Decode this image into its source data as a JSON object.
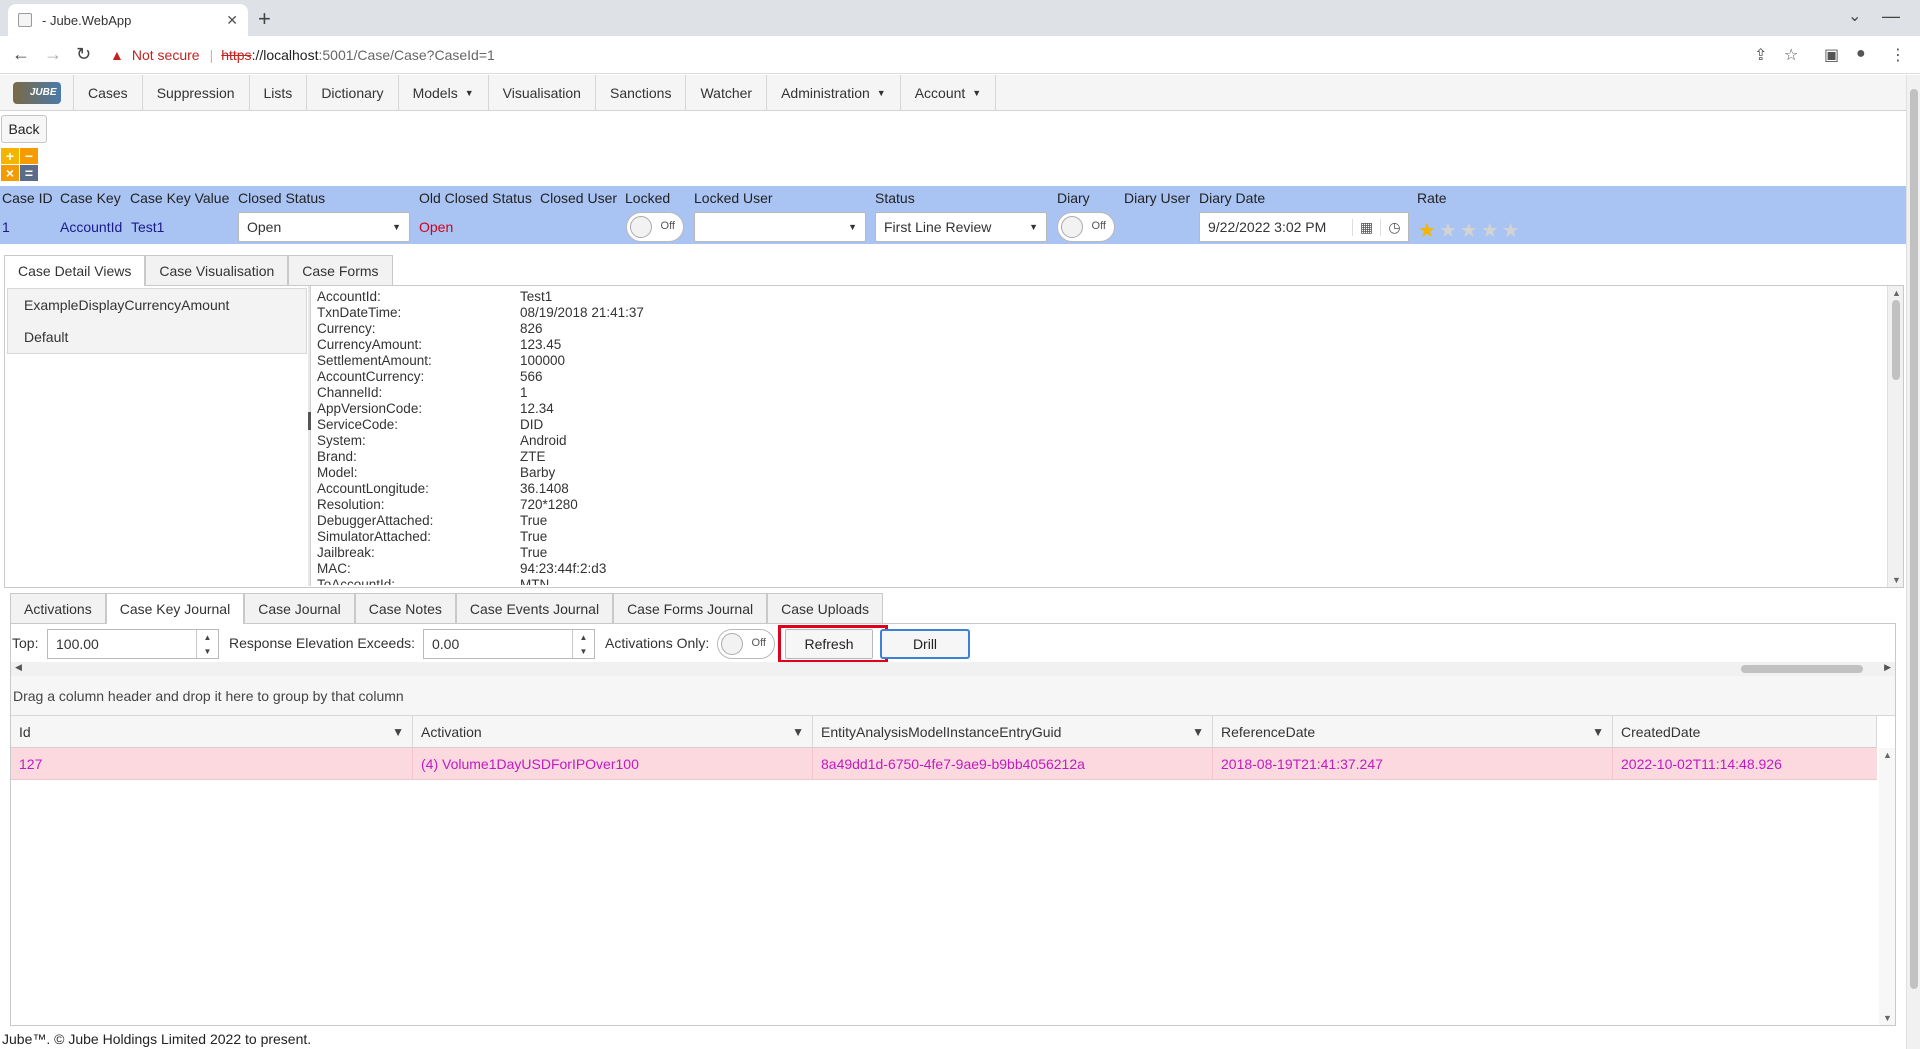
{
  "browser": {
    "tab_title": "- Jube.WebApp",
    "tab_close": "✕",
    "new_tab": "+",
    "not_secure": "Not secure",
    "url_scheme": "https",
    "url_host": "://localhost",
    "url_path": ":5001/Case/Case?CaseId=1"
  },
  "menu": {
    "logo_text": "JUBE",
    "items": [
      {
        "label": "Cases"
      },
      {
        "label": "Suppression"
      },
      {
        "label": "Lists"
      },
      {
        "label": "Dictionary"
      },
      {
        "label": "Models",
        "dropdown": true
      },
      {
        "label": "Visualisation"
      },
      {
        "label": "Sanctions"
      },
      {
        "label": "Watcher"
      },
      {
        "label": "Administration",
        "dropdown": true
      },
      {
        "label": "Account",
        "dropdown": true
      }
    ]
  },
  "back_label": "Back",
  "calc": {
    "plus": "+",
    "minus": "−",
    "times": "×",
    "equals": "="
  },
  "case": {
    "labels": {
      "case_id": "Case ID",
      "case_key": "Case Key",
      "case_key_value": "Case Key Value",
      "closed_status": "Closed Status",
      "old_closed_status": "Old Closed Status",
      "closed_user": "Closed User",
      "locked": "Locked",
      "locked_user": "Locked User",
      "status": "Status",
      "diary": "Diary",
      "diary_user": "Diary User",
      "diary_date": "Diary Date",
      "rate": "Rate"
    },
    "values": {
      "case_id": "1",
      "case_key": "AccountId",
      "case_key_value": "Test1",
      "closed_status": "Open",
      "old_closed_status": "Open",
      "locked_toggle": "Off",
      "locked_user": "",
      "status": "First Line Review",
      "diary_toggle": "Off",
      "diary_date": "9/22/2022 3:02 PM",
      "rating": 1,
      "rating_max": 5
    },
    "colors": {
      "band": "#a9c3f3",
      "old_closed_status": "#d4001a",
      "value_text": "#1a1a8a"
    }
  },
  "upper_tabs": [
    {
      "label": "Case Detail Views",
      "active": true
    },
    {
      "label": "Case Visualisation",
      "active": false
    },
    {
      "label": "Case Forms",
      "active": false
    }
  ],
  "detail_views": [
    "ExampleDisplayCurrencyAmount",
    "Default"
  ],
  "fields": [
    {
      "key": "AccountId:",
      "value": "Test1"
    },
    {
      "key": "TxnDateTime:",
      "value": "08/19/2018 21:41:37"
    },
    {
      "key": "Currency:",
      "value": "826"
    },
    {
      "key": "CurrencyAmount:",
      "value": "123.45"
    },
    {
      "key": "SettlementAmount:",
      "value": "100000"
    },
    {
      "key": "AccountCurrency:",
      "value": "566"
    },
    {
      "key": "ChannelId:",
      "value": "1"
    },
    {
      "key": "AppVersionCode:",
      "value": "12.34"
    },
    {
      "key": "ServiceCode:",
      "value": "DID"
    },
    {
      "key": "System:",
      "value": "Android"
    },
    {
      "key": "Brand:",
      "value": "ZTE"
    },
    {
      "key": "Model:",
      "value": "Barby"
    },
    {
      "key": "AccountLongitude:",
      "value": "36.1408"
    },
    {
      "key": "Resolution:",
      "value": "720*1280"
    },
    {
      "key": "DebuggerAttached:",
      "value": "True"
    },
    {
      "key": "SimulatorAttached:",
      "value": "True"
    },
    {
      "key": "Jailbreak:",
      "value": "True"
    },
    {
      "key": "MAC:",
      "value": "94:23:44f:2:d3"
    },
    {
      "key": "ToAccountId:",
      "value": "MTN"
    }
  ],
  "lower_tabs": [
    {
      "label": "Activations",
      "active": false
    },
    {
      "label": "Case Key Journal",
      "active": true
    },
    {
      "label": "Case Journal",
      "active": false
    },
    {
      "label": "Case Notes",
      "active": false
    },
    {
      "label": "Case Events Journal",
      "active": false
    },
    {
      "label": "Case Forms Journal",
      "active": false
    },
    {
      "label": "Case Uploads",
      "active": false
    }
  ],
  "journal": {
    "top_label": "Top:",
    "top_value": "100.00",
    "elevation_label": "Response Elevation Exceeds:",
    "elevation_value": "0.00",
    "activations_label": "Activations Only:",
    "activations_toggle": "Off",
    "refresh_label": "Refresh",
    "drill_label": "Drill",
    "group_hint": "Drag a column header and drop it here to group by that column",
    "columns": [
      "Id",
      "Activation",
      "EntityAnalysisModelInstanceEntryGuid",
      "ReferenceDate",
      "CreatedDate"
    ],
    "rows": [
      [
        "127",
        "(4) Volume1DayUSDForIPOver100",
        "8a49dd1d-6750-4fe7-9ae9-b9bb4056212a",
        "2018-08-19T21:41:37.247",
        "2022-10-02T11:14:48.926"
      ]
    ],
    "colors": {
      "row_bg": "#fcd9df",
      "row_text": "#c21ac2",
      "highlight": "#e0001b"
    }
  },
  "footer": "Jube™. © Jube Holdings Limited 2022 to present."
}
